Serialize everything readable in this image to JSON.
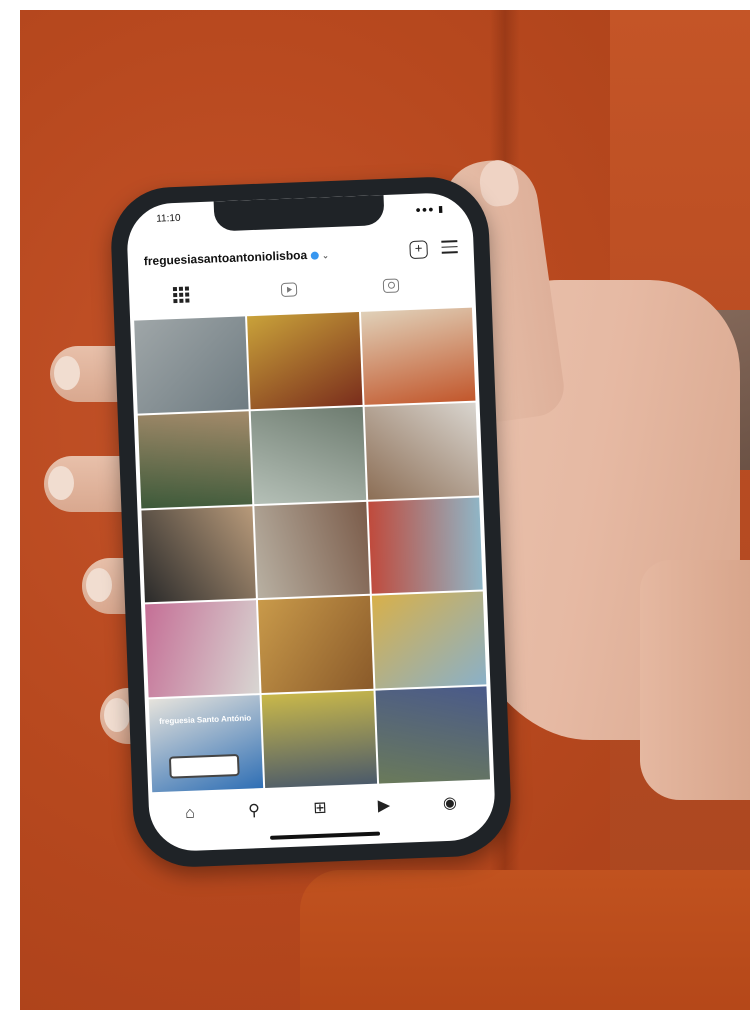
{
  "status_bar": {
    "time": "11:10",
    "signals": "wifi battery"
  },
  "profile": {
    "username": "freguesiasantoantoniolisboa"
  },
  "icons": {
    "add": "plus-square-icon",
    "menu": "hamburger-menu-icon",
    "grid_tab": "grid-icon",
    "reels_tab": "reels-icon",
    "tagged_tab": "tagged-icon",
    "nav": [
      "home-icon",
      "search-icon",
      "create-icon",
      "reels-icon",
      "profile-icon"
    ]
  },
  "posts": [
    {
      "subject": "hand holding phone",
      "colors": [
        "#9fa6a8",
        "#6f7c82"
      ]
    },
    {
      "subject": "yellow mask with drinks",
      "colors": [
        "#c9a23a",
        "#7a2d1c"
      ]
    },
    {
      "subject": "pizzas",
      "colors": [
        "#e0d0b8",
        "#c2572c"
      ]
    },
    {
      "subject": "shop facade",
      "colors": [
        "#a38a6a",
        "#3d5a3a"
      ]
    },
    {
      "subject": "person by window",
      "colors": [
        "#6d7b6f",
        "#b5c0b7"
      ]
    },
    {
      "subject": "table with bread",
      "colors": [
        "#d9d5cf",
        "#8c6e55"
      ]
    },
    {
      "subject": "street market",
      "colors": [
        "#b89a7a",
        "#2a2a2a"
      ]
    },
    {
      "subject": "parade figures",
      "colors": [
        "#7b5c4a",
        "#b8b0a2"
      ]
    },
    {
      "subject": "child with balloons",
      "colors": [
        "#8fb6c7",
        "#c04a3c"
      ]
    },
    {
      "subject": "woman in pink",
      "colors": [
        "#d8d6d2",
        "#c56f96"
      ]
    },
    {
      "subject": "grilled sardines",
      "colors": [
        "#8a5a2a",
        "#c99a4a"
      ]
    },
    {
      "subject": "outdoor event",
      "colors": [
        "#8ab0c8",
        "#d8b04a"
      ]
    },
    {
      "subject": "sign",
      "colors": [
        "#2f6fb5",
        "#e6e3dc"
      ],
      "text": "freguesia Santo António"
    },
    {
      "subject": "couple dancing",
      "colors": [
        "#4b5a6a",
        "#c9b84a"
      ]
    },
    {
      "subject": "crowd",
      "colors": [
        "#6a7a5a",
        "#4a5a8a"
      ]
    }
  ],
  "scene_colors": {
    "background": "#b94c22",
    "skin": "#e6b9a3",
    "phone_body": "#1f2327"
  }
}
